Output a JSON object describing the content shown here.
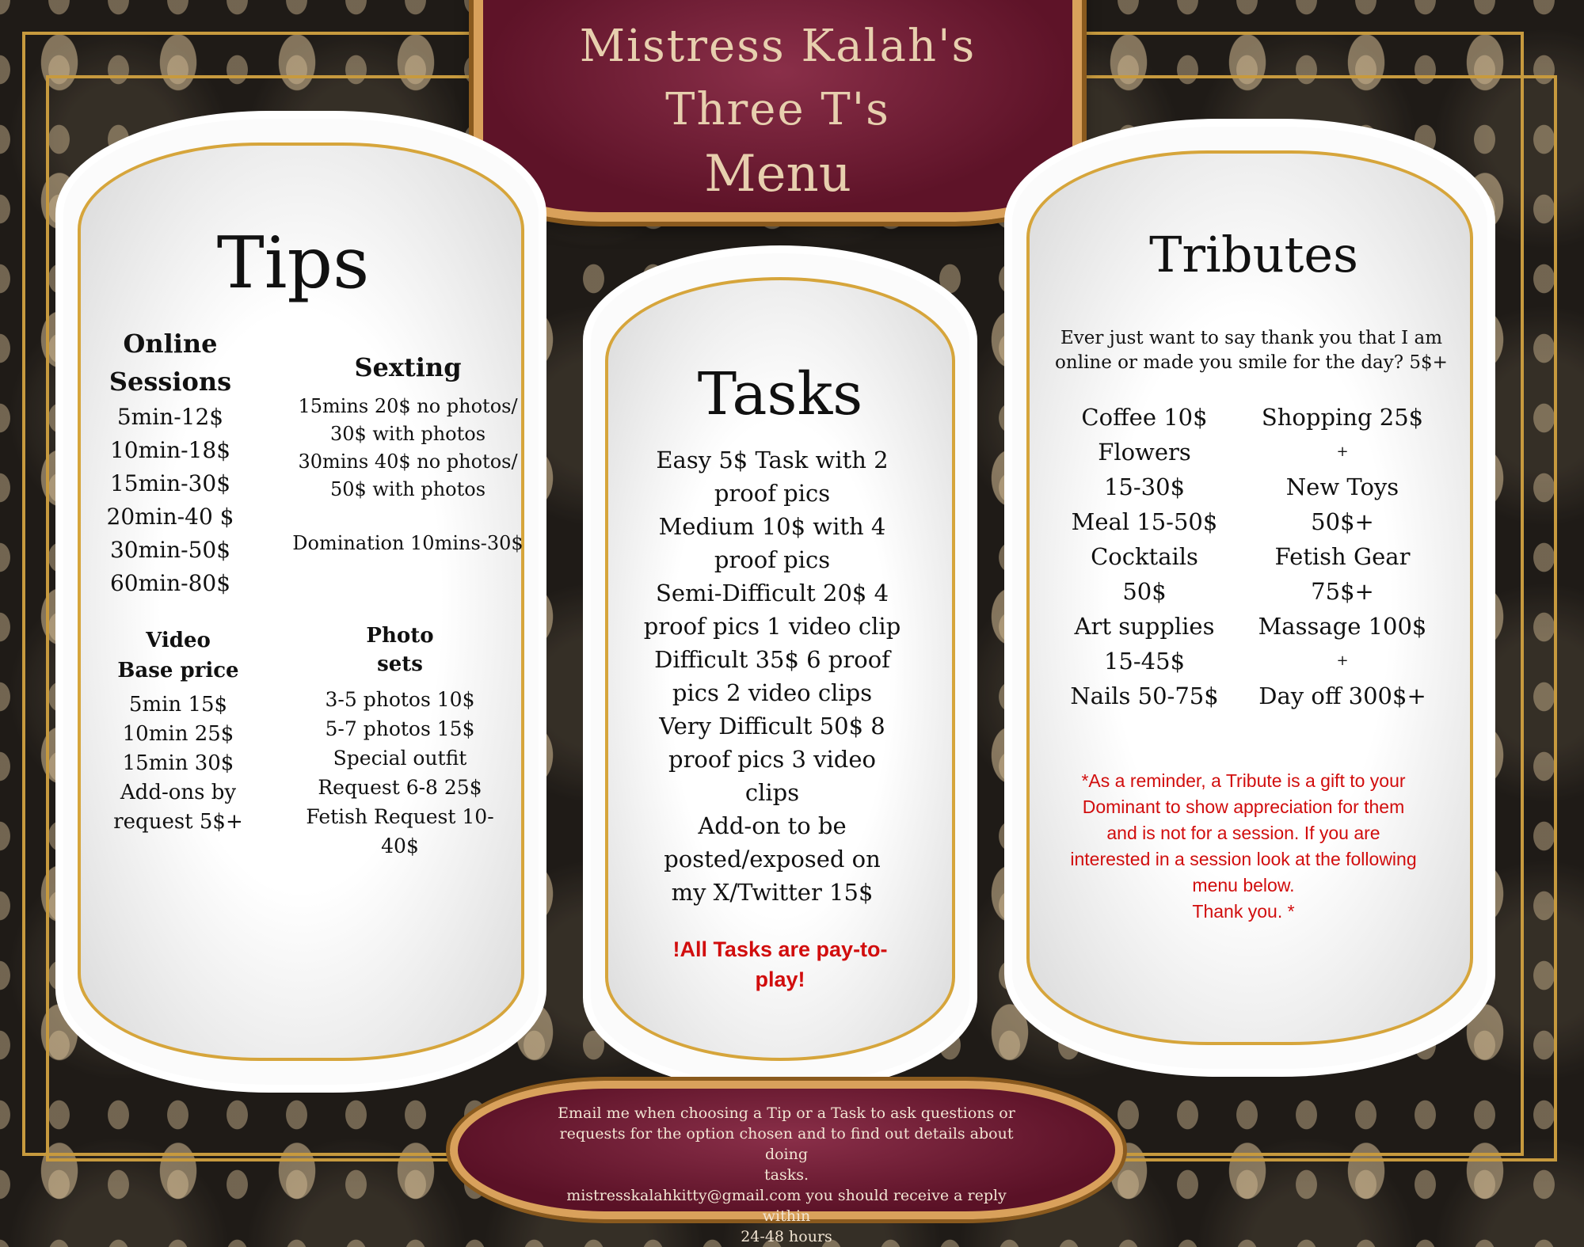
{
  "title": {
    "line1": "Mistress Kalah's",
    "line2": "Three T's",
    "line3": "Menu"
  },
  "tips": {
    "heading": "Tips",
    "online": {
      "title": [
        "Online",
        "Sessions"
      ],
      "items": [
        "5min-12$",
        "10min-18$",
        "15min-30$",
        "20min-40 $",
        "30min-50$",
        "60min-80$"
      ]
    },
    "sexting": {
      "title": "Sexting",
      "items": [
        "15mins 20$ no photos/",
        "30$ with photos",
        "30mins 40$ no photos/",
        "50$ with photos"
      ],
      "domination": "Domination 10mins-30$"
    },
    "video": {
      "title": [
        "Video",
        "Base price"
      ],
      "items": [
        "5min 15$",
        "10min 25$",
        "15min 30$",
        "Add-ons by",
        "request 5$+"
      ]
    },
    "photo": {
      "title": [
        "Photo",
        "sets"
      ],
      "items": [
        "3-5 photos 10$",
        "5-7 photos 15$",
        "Special outfit",
        "Request 6-8 25$",
        "Fetish Request 10-",
        "40$"
      ]
    }
  },
  "tasks": {
    "heading": "Tasks",
    "lines": [
      "Easy 5$ Task with 2",
      "proof pics",
      "Medium 10$ with 4",
      "proof pics",
      "Semi-Difficult 20$ 4",
      "proof pics 1 video clip",
      "Difficult 35$ 6 proof",
      "pics 2 video clips",
      "Very Difficult 50$ 8",
      "proof pics 3 video",
      "clips",
      "Add-on to be",
      "posted/exposed on",
      "my X/Twitter 15$"
    ],
    "note": [
      "!All Tasks are pay-to-",
      "play!"
    ]
  },
  "tributes": {
    "heading": "Tributes",
    "intro": [
      "Ever just want to say thank you that I am",
      "online or made you smile for the day?  5$+"
    ],
    "left": [
      "Coffee 10$",
      "Flowers",
      "15-30$",
      "Meal 15-50$",
      "Cocktails",
      "50$",
      "Art supplies",
      "15-45$",
      "Nails 50-75$"
    ],
    "right": [
      "Shopping 25$",
      "+",
      "New Toys",
      "50$+",
      "Fetish Gear",
      "75$+",
      "Massage 100$",
      "+",
      "Day off 300$+"
    ],
    "note": [
      "*As a reminder, a Tribute is a gift to your",
      "Dominant to show appreciation for them",
      "and is not for a session. If you are",
      "interested in a session look at the following",
      "menu below.",
      "Thank you. *"
    ]
  },
  "footer": {
    "lines": [
      "Email me when choosing a Tip or a Task to ask questions or",
      "requests for the option chosen and to find out details about doing",
      "tasks.",
      "mistresskalahkitty@gmail.com you should receive a reply within",
      "24-48 hours"
    ]
  },
  "colors": {
    "maroon": "#6e1a33",
    "gold": "#d9a15b",
    "red_text": "#d10d0d",
    "banner_text": "#e7cfae"
  }
}
